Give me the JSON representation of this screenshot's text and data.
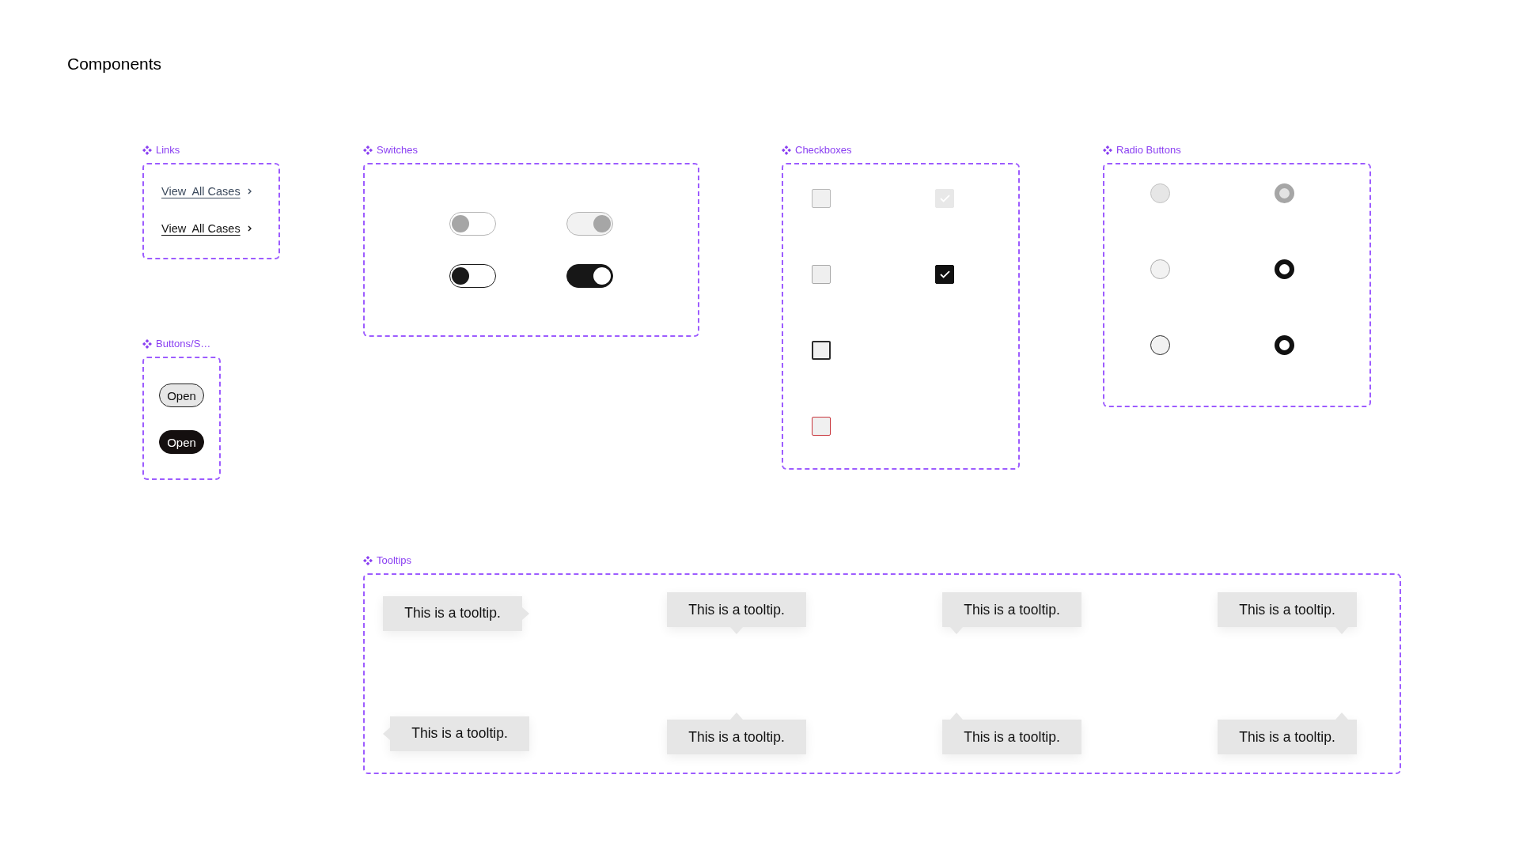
{
  "page_title": "Components",
  "links": {
    "label": "Links",
    "items": [
      {
        "text": "View  All Cases",
        "hovered": false
      },
      {
        "text": "View  All Cases",
        "hovered": true
      }
    ]
  },
  "buttons": {
    "label": "Buttons/S…",
    "items": [
      {
        "text": "Open",
        "kind": "secondary"
      },
      {
        "text": "Open",
        "kind": "primary"
      }
    ]
  },
  "switches": {
    "label": "Switches",
    "items": [
      {
        "on": false,
        "disabled": true
      },
      {
        "on": true,
        "disabled": true
      },
      {
        "on": false,
        "disabled": false
      },
      {
        "on": true,
        "disabled": false
      }
    ]
  },
  "checkboxes": {
    "label": "Checkboxes",
    "rows": [
      [
        {
          "checked": false,
          "kind": "disabled"
        },
        {
          "checked": true,
          "kind": "disabled"
        }
      ],
      [
        {
          "checked": false,
          "kind": "default"
        },
        {
          "checked": true,
          "kind": "default"
        }
      ],
      [
        {
          "checked": false,
          "kind": "focused"
        }
      ],
      [
        {
          "checked": false,
          "kind": "error"
        }
      ]
    ]
  },
  "radio_buttons": {
    "label": "Radio Buttons",
    "rows": [
      [
        {
          "selected": false,
          "kind": "disabled"
        },
        {
          "selected": true,
          "kind": "disabled"
        }
      ],
      [
        {
          "selected": false,
          "kind": "default"
        },
        {
          "selected": true,
          "kind": "default"
        }
      ],
      [
        {
          "selected": false,
          "kind": "focused"
        },
        {
          "selected": true,
          "kind": "default"
        }
      ]
    ]
  },
  "tooltips": {
    "label": "Tooltips",
    "items": [
      {
        "text": "This is a tooltip.",
        "kind": "right"
      },
      {
        "text": "This is a tooltip.",
        "kind": "bottom"
      },
      {
        "text": "This is a tooltip.",
        "kind": "bottomleft"
      },
      {
        "text": "This is a tooltip.",
        "kind": "bottomright"
      },
      {
        "text": "This is a tooltip.",
        "kind": "left"
      },
      {
        "text": "This is a tooltip.",
        "kind": "top"
      },
      {
        "text": "This is a tooltip.",
        "kind": "topleft"
      },
      {
        "text": "This is a tooltip.",
        "kind": "topright"
      }
    ]
  }
}
